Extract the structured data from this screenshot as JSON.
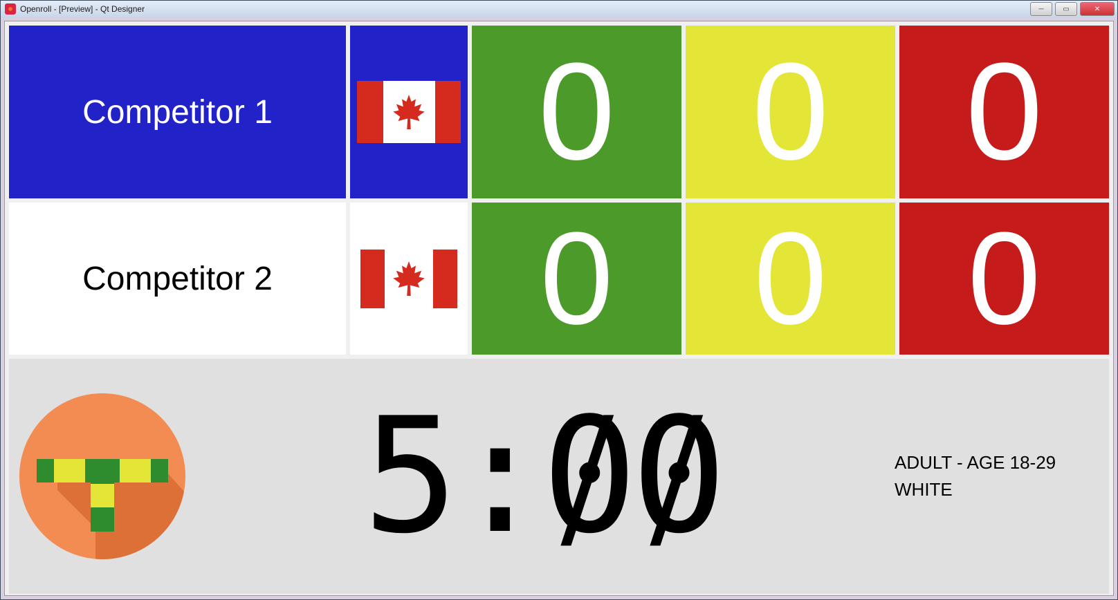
{
  "window": {
    "title": "Openroll - [Preview] - Qt Designer"
  },
  "competitor1": {
    "name": "Competitor 1",
    "flag": "canada",
    "points": "0",
    "advantages": "0",
    "penalties": "0"
  },
  "competitor2": {
    "name": "Competitor 2",
    "flag": "canada",
    "points": "0",
    "advantages": "0",
    "penalties": "0"
  },
  "timer": "5:00",
  "division": {
    "age": "ADULT - AGE 18-29",
    "belt": "WHITE"
  },
  "colors": {
    "blue": "#2222c9",
    "green": "#4c9a2a",
    "yellow": "#e3e636",
    "red": "#c61b1b",
    "logo_bg": "#f28c52"
  }
}
